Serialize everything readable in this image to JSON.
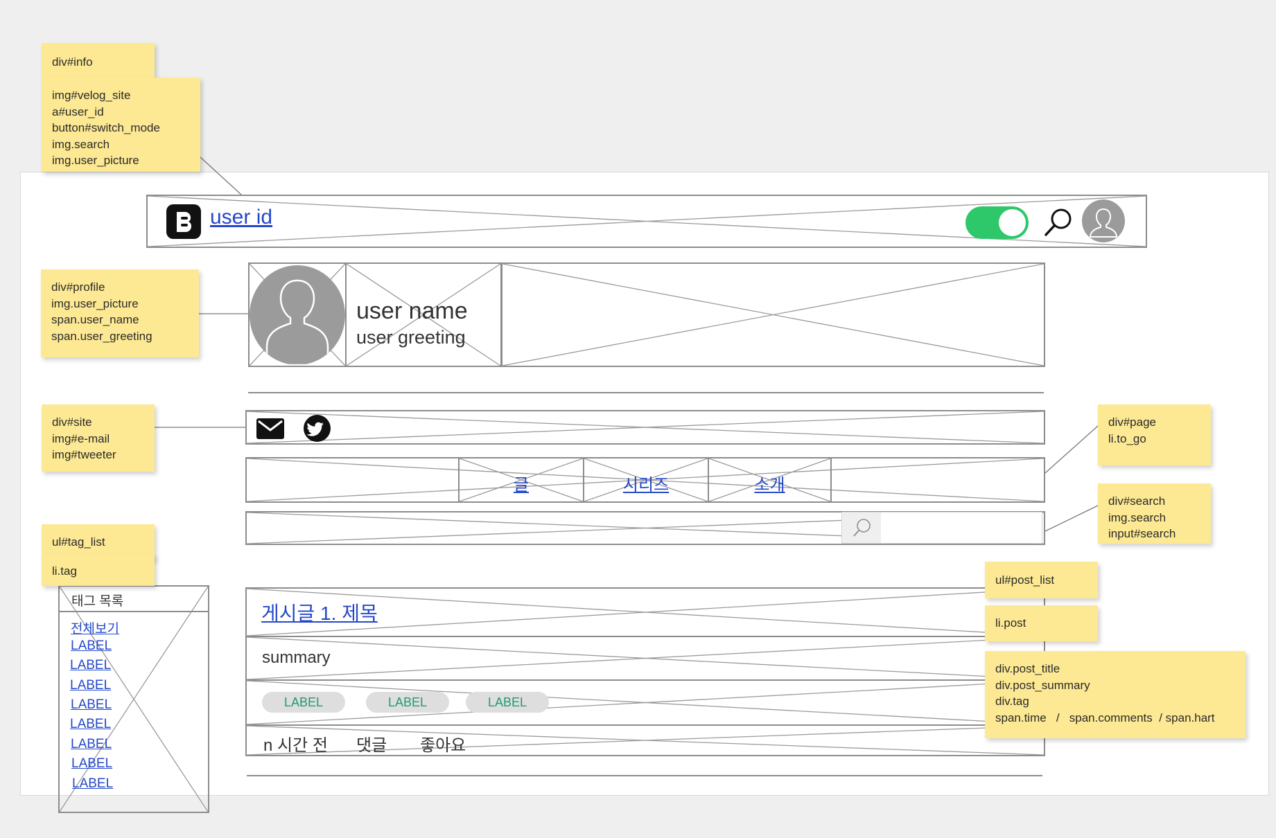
{
  "header": {
    "user_id": "user id",
    "toggle_on": true,
    "colors": {
      "toggle": "#2ec86b",
      "avatar": "#9b9b9b",
      "link": "#2448c9",
      "note": "#fde993",
      "tag_text": "#1f9c6b"
    }
  },
  "profile": {
    "user_name": "user name",
    "user_greeting": "user greeting"
  },
  "site": {
    "icons": [
      "mail-icon",
      "twitter-icon"
    ]
  },
  "page_tabs": [
    "글",
    "시리즈",
    "소개"
  ],
  "search": {
    "icon": "search-icon",
    "placeholder": ""
  },
  "tag_list": {
    "title": "태그 목록",
    "items": [
      "전체보기",
      "LABEL",
      "LABEL",
      "LABEL",
      "LABEL",
      "LABEL",
      "LABEL",
      "LABEL",
      "LABEL"
    ]
  },
  "post": {
    "title": "게시글 1. 제목",
    "summary": "summary",
    "tags": [
      "LABEL",
      "LABEL",
      "LABEL"
    ],
    "time": "n 시간 전",
    "comments": "댓글",
    "likes": "좋아요"
  },
  "notes": {
    "info": [
      "div#info"
    ],
    "info_items": [
      "img#velog_site",
      "a#user_id",
      "button#switch_mode",
      "img.search",
      "img.user_picture"
    ],
    "profile": [
      "div#profile",
      "img.user_picture",
      "span.user_name",
      "span.user_greeting"
    ],
    "site": [
      "div#site",
      "img#e-mail",
      "img#tweeter"
    ],
    "tag_list": [
      "ul#tag_list"
    ],
    "tag_item": [
      "li.tag"
    ],
    "page": [
      "div#page",
      "li.to_go"
    ],
    "search": [
      "div#search",
      "img.search",
      "input#search"
    ],
    "post_list": [
      "ul#post_list"
    ],
    "post_item": [
      "li.post"
    ],
    "post_parts": [
      "div.post_title",
      "div.post_summary",
      "div.tag",
      "span.time   /   span.comments  / span.hart"
    ]
  }
}
